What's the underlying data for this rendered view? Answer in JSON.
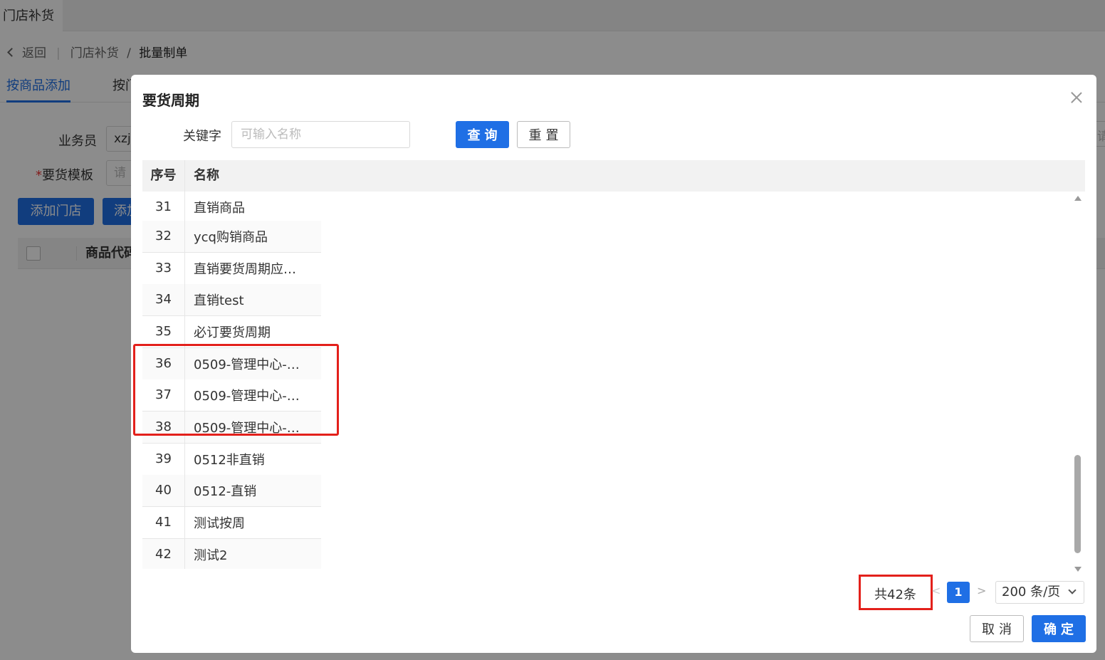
{
  "app": {
    "tab_title": "门店补货"
  },
  "breadcrumb": {
    "back_label": "返回",
    "parent": "门店补货",
    "separator": "/",
    "current": "批量制单"
  },
  "subtabs": [
    "按商品添加",
    "按门"
  ],
  "form": {
    "salesman_label": "业务员",
    "salesman_value": "xzj",
    "template_required_mark": "*",
    "template_label": "要货模板",
    "template_placeholder": "请",
    "add_store_button": "添加门店",
    "add_other_button": "添加",
    "right_input_fragment": "请"
  },
  "bg_table": {
    "col_product_code": "商品代码"
  },
  "modal": {
    "title": "要货周期",
    "keyword_label": "关键字",
    "keyword_placeholder": "可输入名称",
    "query_button": "查询",
    "reset_button": "重置",
    "columns": {
      "no": "序号",
      "name": "名称"
    },
    "rows": [
      {
        "no": "31",
        "name": "直销商品"
      },
      {
        "no": "32",
        "name": "ycq购销商品"
      },
      {
        "no": "33",
        "name": "直销要货周期应…"
      },
      {
        "no": "34",
        "name": "直销test"
      },
      {
        "no": "35",
        "name": "必订要货周期"
      },
      {
        "no": "36",
        "name": "0509-管理中心-…"
      },
      {
        "no": "37",
        "name": "0509-管理中心-…"
      },
      {
        "no": "38",
        "name": "0509-管理中心-…"
      },
      {
        "no": "39",
        "name": "0512非直销"
      },
      {
        "no": "40",
        "name": "0512-直销"
      },
      {
        "no": "41",
        "name": "测试按周"
      },
      {
        "no": "42",
        "name": "测试2"
      }
    ],
    "pagination": {
      "total_text": "共42条",
      "prev": "<",
      "current_page": "1",
      "next": ">",
      "page_size": "200 条/页"
    },
    "cancel_button": "取消",
    "ok_button": "确定"
  },
  "colors": {
    "primary": "#1f6fe5",
    "highlight": "#e3201b"
  }
}
